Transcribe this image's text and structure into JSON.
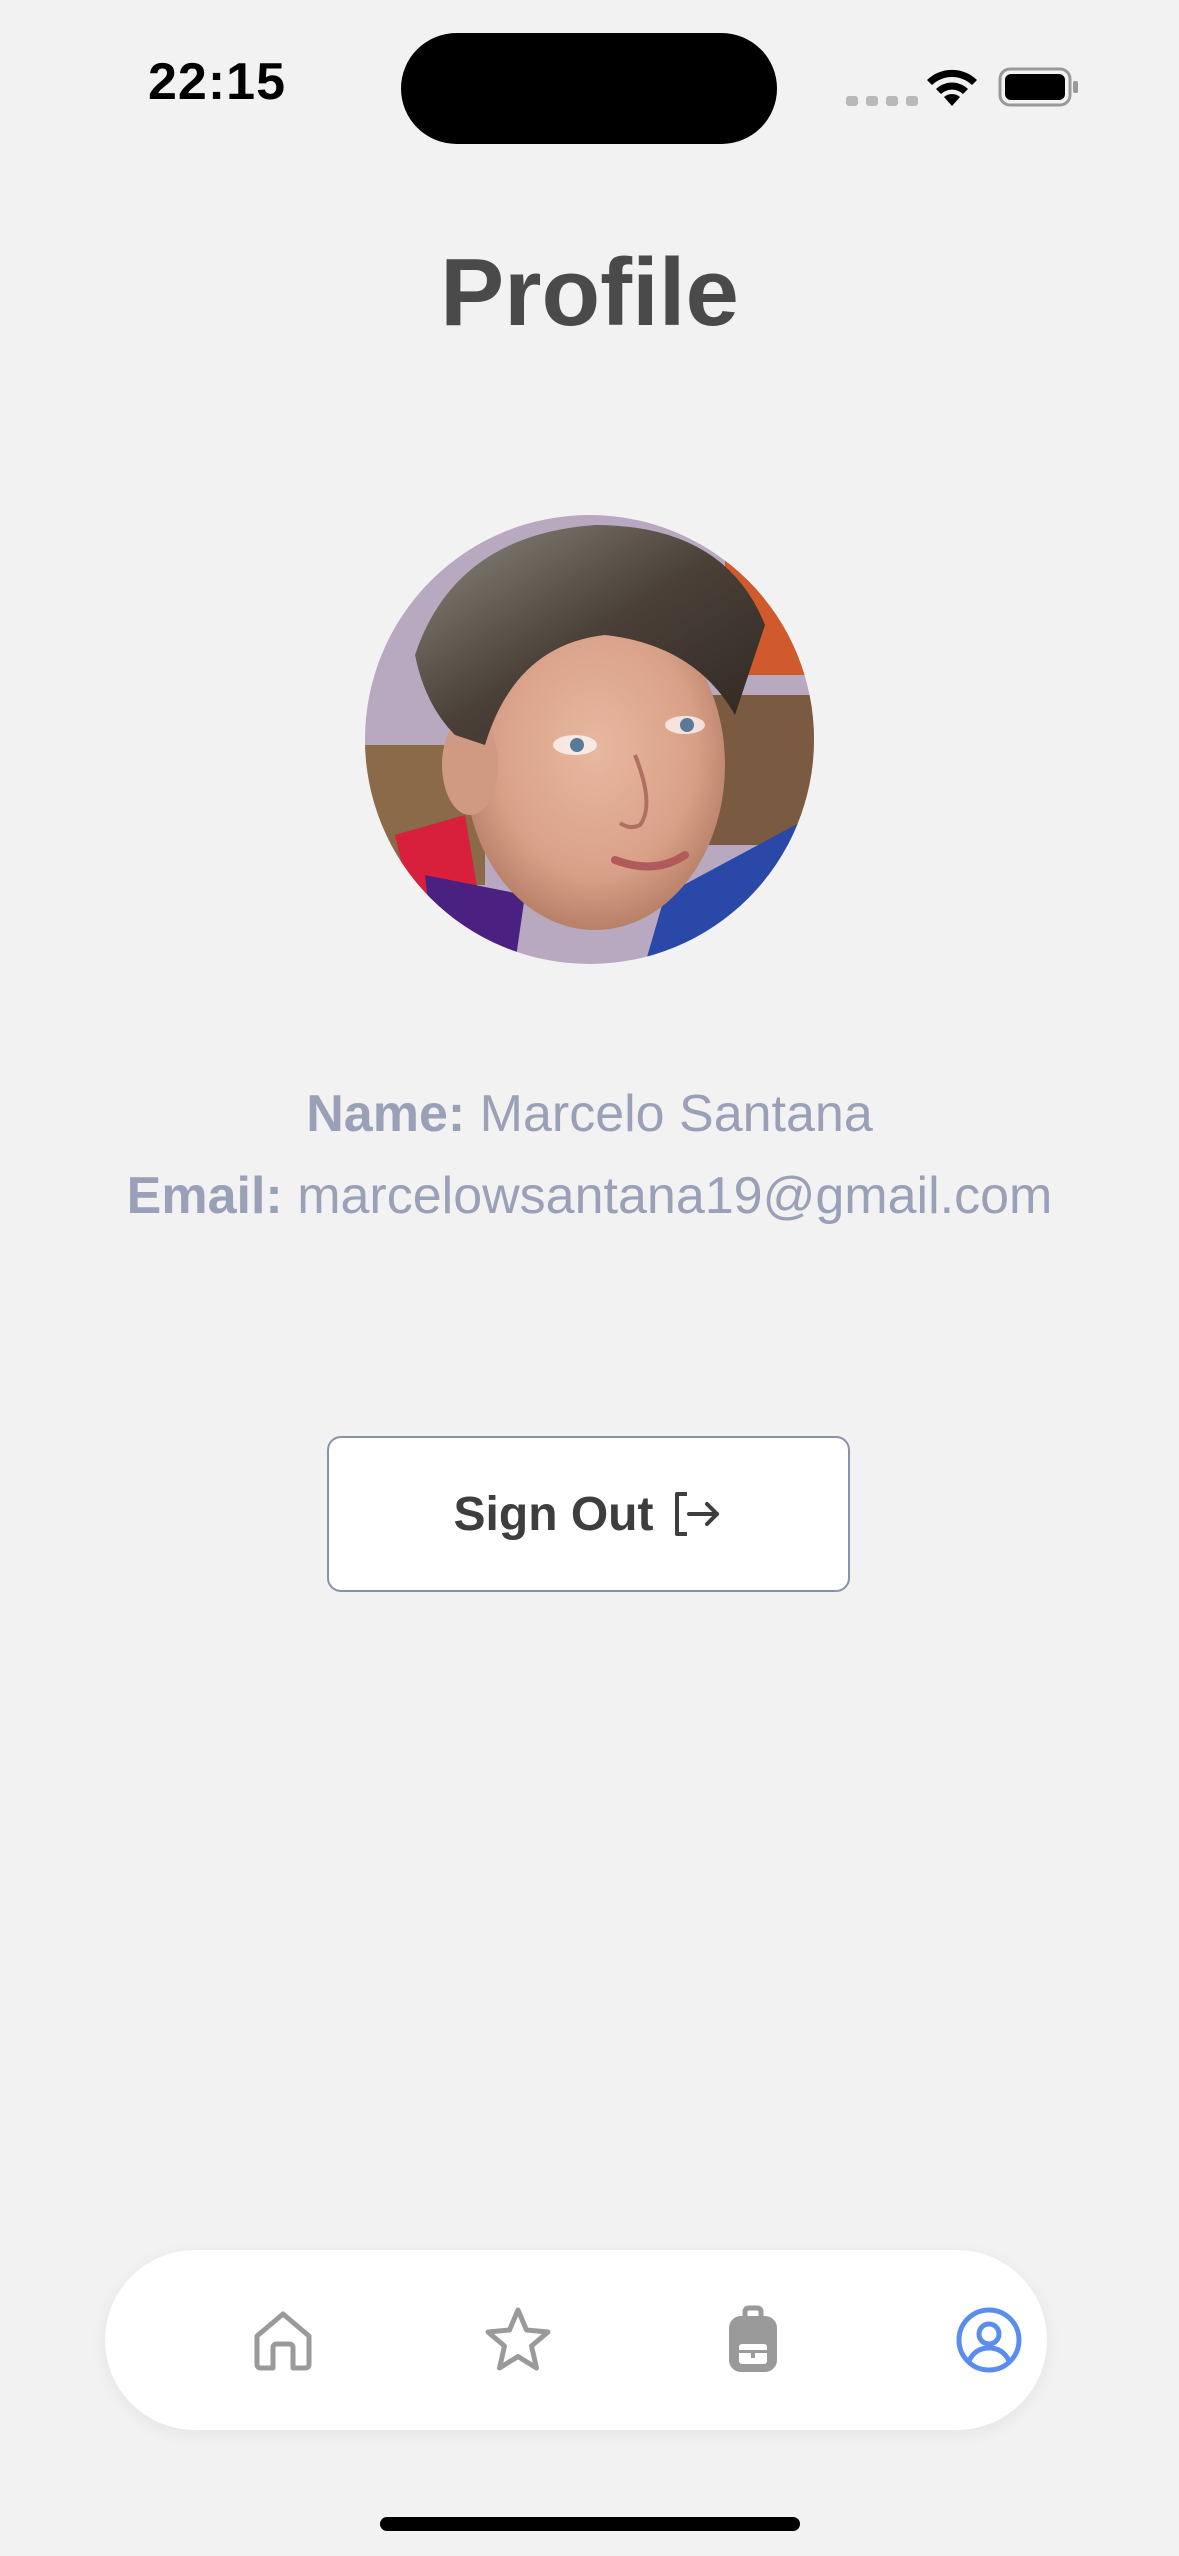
{
  "status_bar": {
    "time": "22:15"
  },
  "page": {
    "title": "Profile"
  },
  "profile": {
    "name_label": "Name:",
    "name_value": "Marcelo Santana",
    "email_label": "Email:",
    "email_value": "marcelowsantana19@gmail.com"
  },
  "actions": {
    "sign_out_label": "Sign Out",
    "sign_out_icon": "logout-icon"
  },
  "tab_bar": {
    "items": [
      {
        "icon": "home-icon",
        "active": false
      },
      {
        "icon": "star-icon",
        "active": false
      },
      {
        "icon": "backpack-icon",
        "active": false
      },
      {
        "icon": "user-circle-icon",
        "active": true
      }
    ],
    "active_color": "#5b8def",
    "inactive_color": "#9a9a9a"
  },
  "colors": {
    "background": "#f2f2f2",
    "title": "#4a4a4a",
    "info_text": "#9aa0b7"
  }
}
